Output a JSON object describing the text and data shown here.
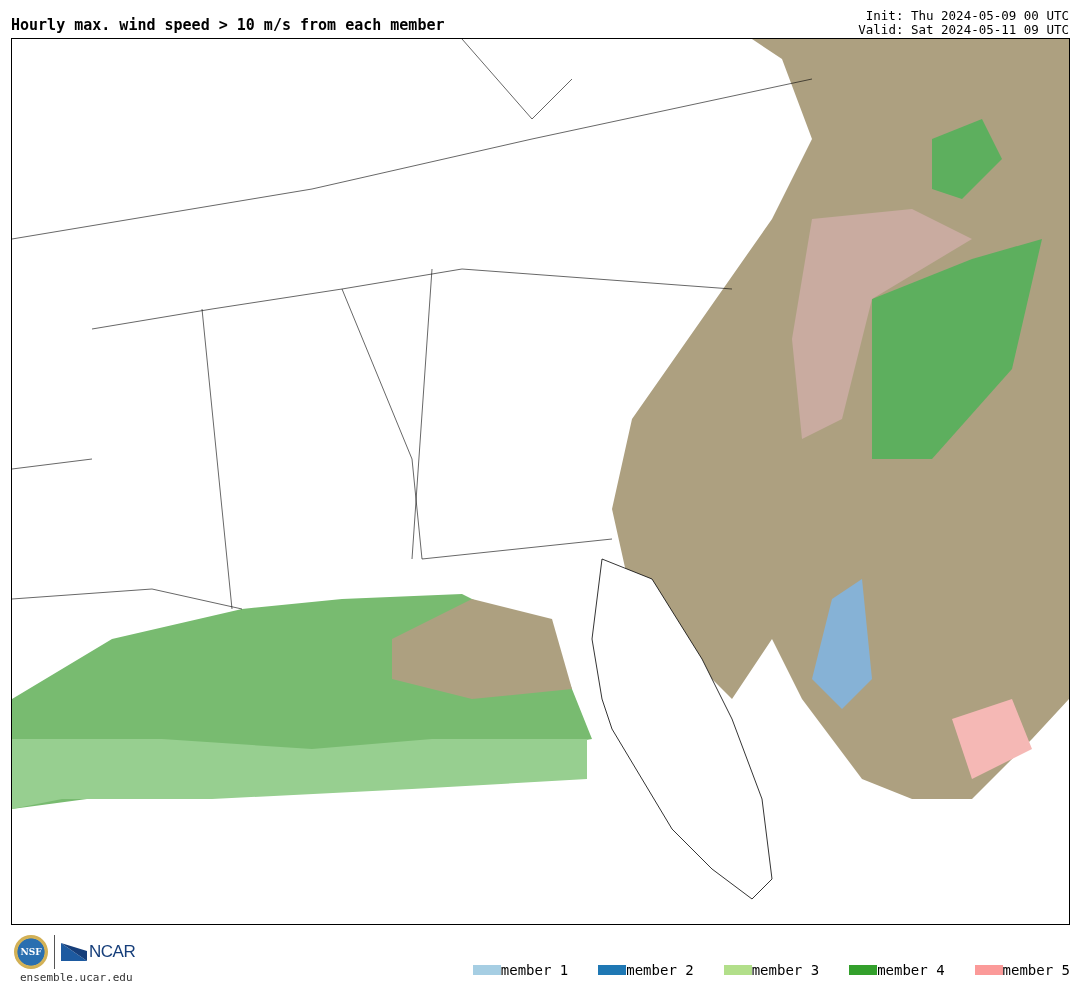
{
  "title": "Hourly max. wind speed > 10 m/s from each member",
  "init": "Init: Thu 2024-05-09 00 UTC",
  "valid": "Valid: Sat 2024-05-11 09 UTC",
  "logos": {
    "nsf": "NSF",
    "ncar": "NCAR"
  },
  "url": "ensemble.ucar.edu",
  "legend": [
    {
      "label": "member 1",
      "color": "#a6cee3"
    },
    {
      "label": "member 2",
      "color": "#1f78b4"
    },
    {
      "label": "member 3",
      "color": "#b2df8a"
    },
    {
      "label": "member 4",
      "color": "#33a02c"
    },
    {
      "label": "member 5",
      "color": "#fb9a99"
    }
  ]
}
